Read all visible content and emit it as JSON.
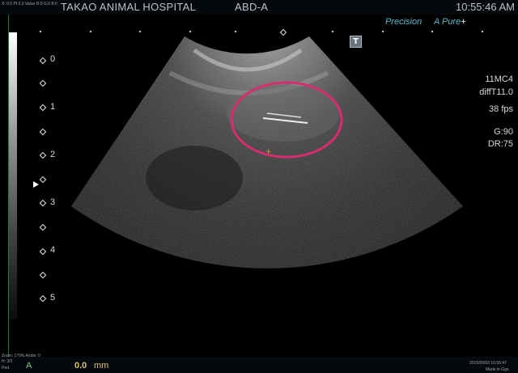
{
  "header": {
    "tiny_info": "X: 0.0 Pt 0.3 Value R:0 G:0 B:0",
    "hospital": "TAKAO ANIMAL HOSPITAL",
    "preset": "ABD-A",
    "time": "10:55:46 AM"
  },
  "branding": {
    "precision": "Precision",
    "apure": "A Pure",
    "plus": "+"
  },
  "t_button": "T",
  "params": {
    "probe": "11MC4",
    "mode": "diffT11.0",
    "fps": "38 fps",
    "gain": "G:90",
    "dr": "DR:75"
  },
  "depth_scale": [
    "0",
    "1",
    "2",
    "3",
    "4",
    "5"
  ],
  "footer": {
    "zoom": "Zoom: 179% Angle: 0",
    "left_small": "H: 3/3",
    "left_small2": "Ped",
    "measure_label": "A",
    "measure_value": "0.0",
    "measure_unit": "mm",
    "date": "2015/09/03 10:55:47",
    "made_in": "Made in Ggn"
  },
  "colors": {
    "annotation": "#d62d6e",
    "marker": "#d9a32b"
  }
}
